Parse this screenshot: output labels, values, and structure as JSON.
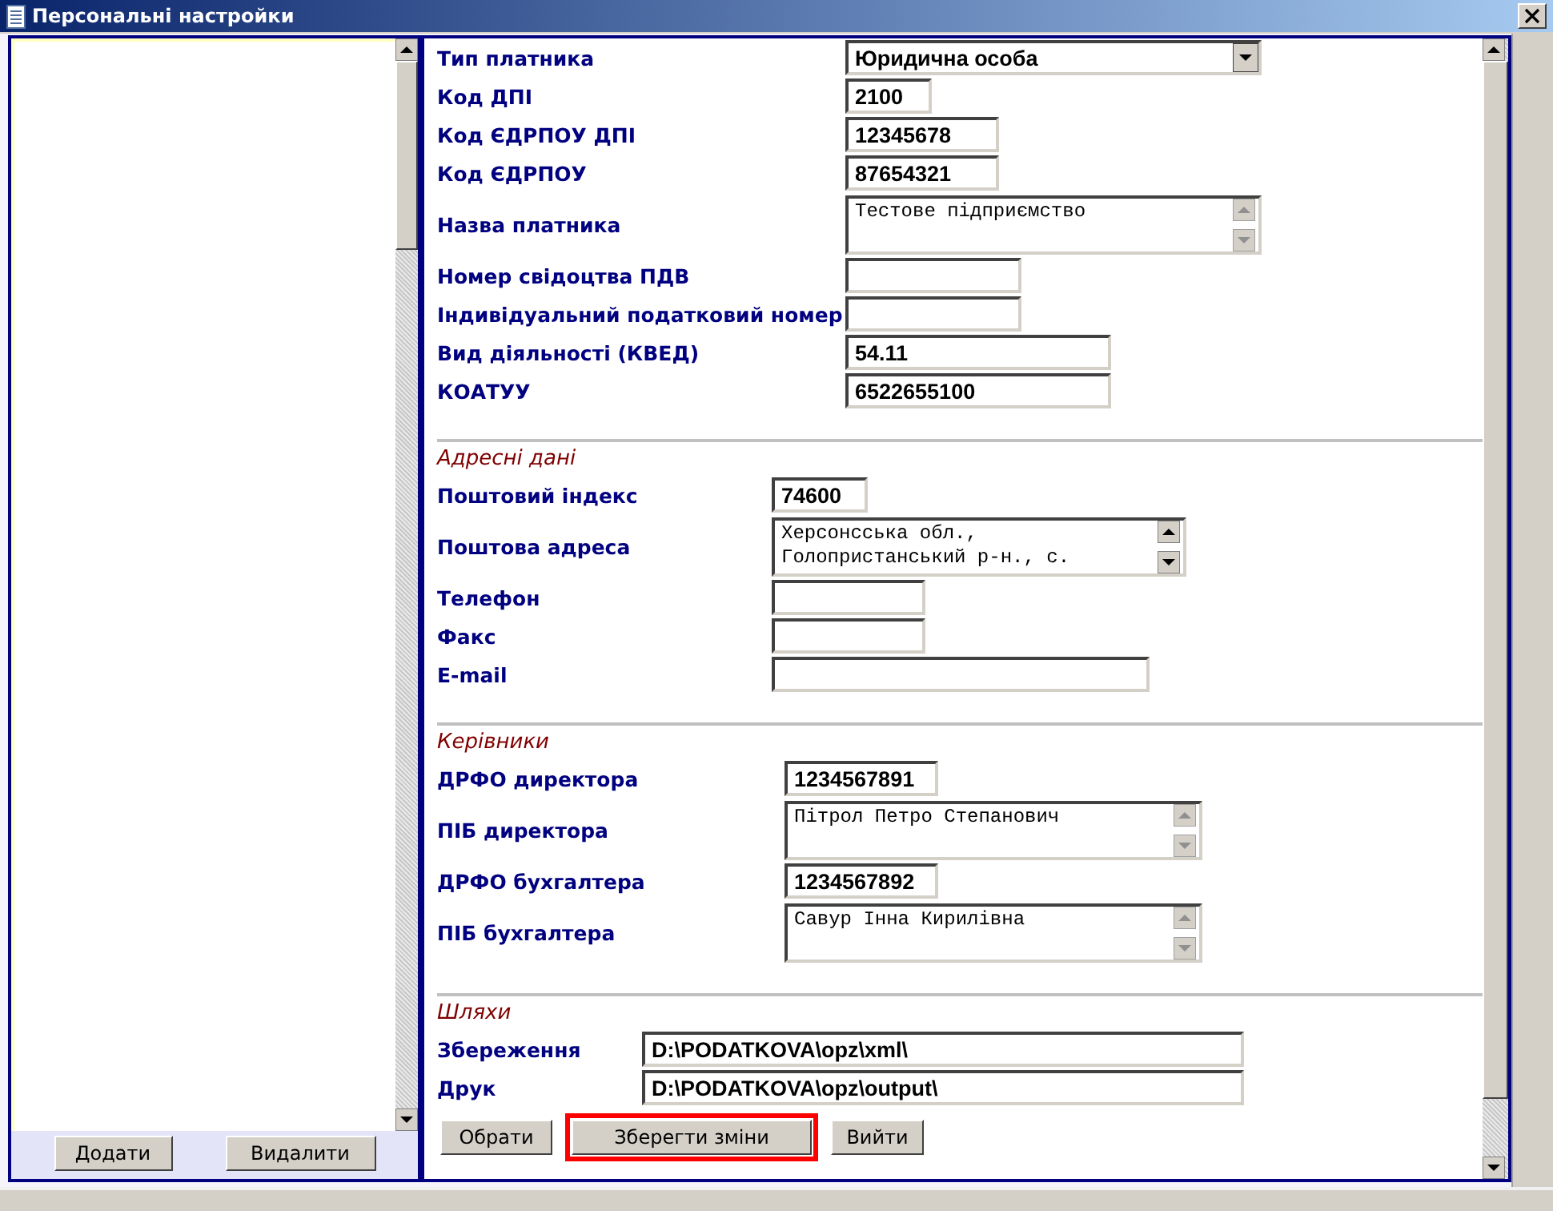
{
  "window": {
    "title": "Персональні настройки"
  },
  "left_panel": {
    "buttons": [
      {
        "label": "Додати"
      },
      {
        "label": "Видалити"
      }
    ]
  },
  "sections": [
    {
      "fields": [
        {
          "label": "Тип платника",
          "kind": "select",
          "value": "Юридична особа"
        },
        {
          "label": "Код ДПІ",
          "kind": "text",
          "value": "2100"
        },
        {
          "label": "Код ЄДРПОУ ДПІ",
          "kind": "text",
          "value": "12345678"
        },
        {
          "label": "Код ЄДРПОУ",
          "kind": "text",
          "value": "87654321"
        },
        {
          "label": "Назва платника",
          "kind": "textarea",
          "value": "Тестове підприємство"
        },
        {
          "label": "Номер свідоцтва ПДВ",
          "kind": "text"
        },
        {
          "label": "Індивідуальний податковий номер",
          "kind": "text"
        },
        {
          "label": "Вид діяльності (КВЕД)",
          "kind": "text",
          "value": "54.11"
        },
        {
          "label": "КОАТУУ",
          "kind": "text",
          "value": "6522655100"
        }
      ]
    },
    {
      "title": "Адресні дані",
      "fields": [
        {
          "label": "Поштовий індекс",
          "kind": "text",
          "value": "74600"
        },
        {
          "label": "Поштова адреса",
          "kind": "textarea",
          "value": "Херсонсська обл.,\nГолопристанський р-н., с."
        },
        {
          "label": "Телефон",
          "kind": "text"
        },
        {
          "label": "Факс",
          "kind": "text"
        },
        {
          "label": "E-mail",
          "kind": "text"
        }
      ]
    },
    {
      "title": "Керівники",
      "fields": [
        {
          "label": "ДРФО директора",
          "kind": "text",
          "value": "1234567891"
        },
        {
          "label": "ПІБ директора",
          "kind": "textarea",
          "value": "Пітрол Петро Степанович"
        },
        {
          "label": "ДРФО бухгалтера",
          "kind": "text",
          "value": "1234567892"
        },
        {
          "label": "ПІБ бухгалтера",
          "kind": "textarea",
          "value": "Савур Інна Кирилівна"
        }
      ]
    },
    {
      "title": "Шляхи",
      "fields": [
        {
          "label": "Збереження",
          "kind": "text",
          "value": "D:\\PODATKOVA\\opz\\xml\\"
        },
        {
          "label": "Друк",
          "kind": "text",
          "value": "D:\\PODATKOVA\\opz\\output\\"
        }
      ]
    }
  ],
  "buttons": [
    {
      "label": "Обрати",
      "highlighted": false
    },
    {
      "label": "Зберегти зміни",
      "highlighted": true
    },
    {
      "label": "Вийти",
      "highlighted": false
    }
  ]
}
